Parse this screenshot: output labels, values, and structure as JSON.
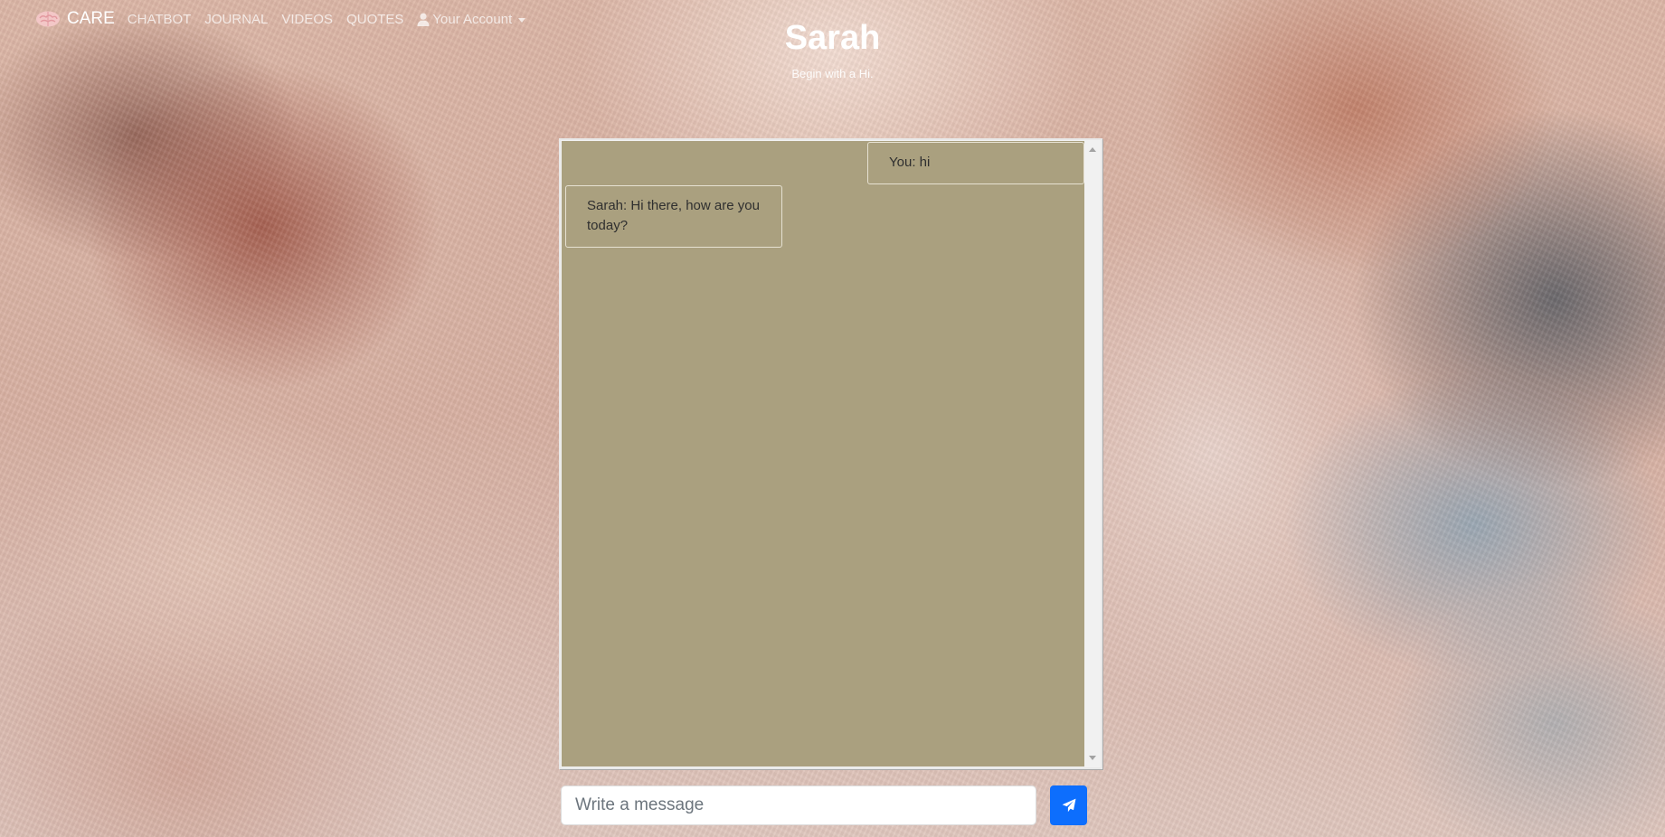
{
  "navbar": {
    "brand_label": "CARE",
    "brand_icon": "brain-icon",
    "links": [
      {
        "label": "CHATBOT"
      },
      {
        "label": "JOURNAL"
      },
      {
        "label": "VIDEOS"
      },
      {
        "label": "QUOTES"
      }
    ],
    "account": {
      "label": "Your Account",
      "icon": "user-icon"
    }
  },
  "header": {
    "title": "Sarah",
    "subtitle": "Begin with a Hi."
  },
  "chat": {
    "messages": [
      {
        "sender": "user",
        "text": "You: hi"
      },
      {
        "sender": "bot",
        "text": "Sarah: Hi there, how are you today?"
      }
    ],
    "background_color": "#aaa07f"
  },
  "composer": {
    "placeholder": "Write a message",
    "value": "",
    "send_icon": "paper-plane-icon",
    "send_color": "#0d6efd"
  }
}
